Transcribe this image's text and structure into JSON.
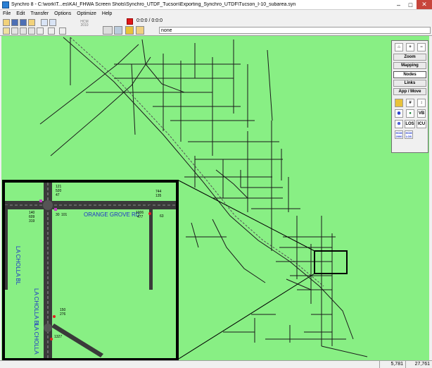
{
  "window": {
    "title": "Synchro 8 - C:\\work\\T...es\\KAI_FHWA Screen Shots\\Synchro_UTDF_Tucson\\Exporting_Synchro_UTDF\\Tucson_I-10_subarea.syn",
    "minimize": "–",
    "maximize": "□",
    "close": "✕"
  },
  "menu": [
    "File",
    "Edit",
    "Transfer",
    "Options",
    "Optimize",
    "Help"
  ],
  "toolbar": {
    "hcm_label": "HCM 2010",
    "time_counter": "0:0:0 / 0:0:0",
    "node_selector": "none"
  },
  "palette": {
    "buttons": [
      "Zoom",
      "Mapping",
      "Nodes",
      "Links",
      "App / Move"
    ],
    "active_button": "Nodes",
    "icons": [
      "LOS",
      "ICU",
      "VB",
      "HCM 2000",
      "HCM LOS"
    ]
  },
  "inset": {
    "street_names": [
      "ORANGE GROVE RD",
      "LA CHOLLA BL",
      "LA CHOLLA BL",
      "LA CHOLLA"
    ],
    "volumes": [
      "121",
      "520",
      "47",
      "744",
      "135",
      "140",
      "609",
      "319",
      "1006",
      "477",
      "30",
      "101",
      "63",
      "150",
      "276",
      "1327"
    ]
  },
  "status": {
    "x_coord": "5,781",
    "y_coord": "27,761"
  },
  "colors": {
    "map_background": "#88ef84",
    "link": "#1a1a1a",
    "inset_road": "#3a3a3a",
    "street_label": "#1d34c8"
  }
}
